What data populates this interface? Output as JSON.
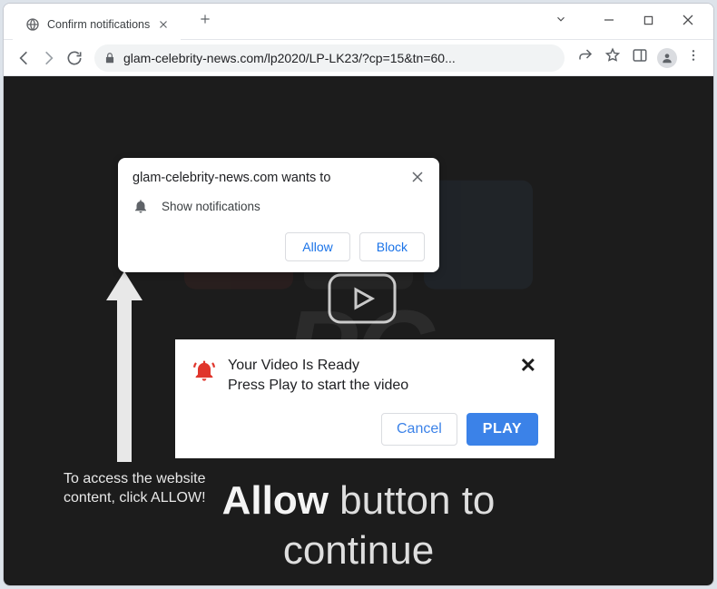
{
  "tab": {
    "title": "Confirm notifications"
  },
  "omnibox": {
    "url": "glam-celebrity-news.com/lp2020/LP-LK23/?cp=15&tn=60..."
  },
  "perm": {
    "origin": "glam-celebrity-news.com wants to",
    "label": "Show notifications",
    "allow": "Allow",
    "block": "Block"
  },
  "vpop": {
    "line1": "Your Video Is Ready",
    "line2": "Press Play to start the video",
    "cancel": "Cancel",
    "play": "PLAY"
  },
  "page": {
    "small_line1": "To access the website",
    "small_line2": "content, click ALLOW!",
    "big_bold": "Allow",
    "big_rest1": " button to",
    "big_rest2": "continue"
  },
  "colors": {
    "accent": "#1a73e8",
    "play": "#3b82e8"
  }
}
